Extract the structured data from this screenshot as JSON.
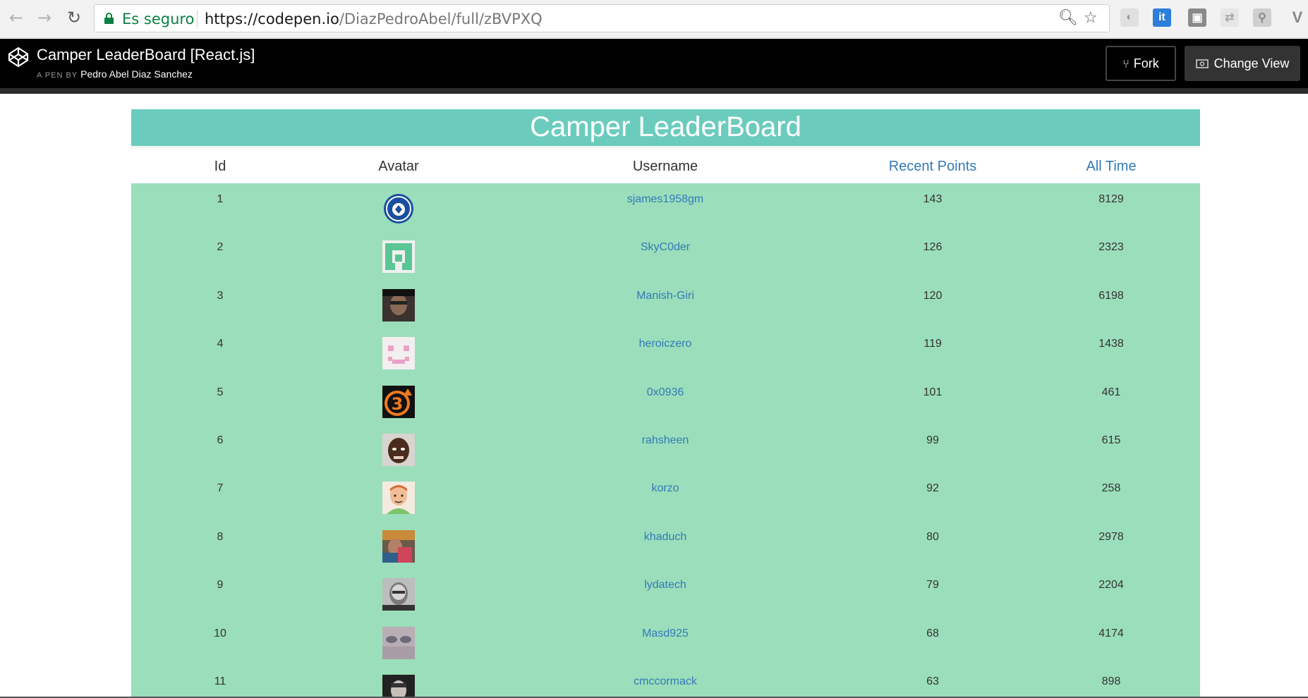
{
  "browser": {
    "secure_label": "Es seguro",
    "url_host": "https://codepen.io",
    "url_path": "/DiazPedroAbel/full/zBVPXQ"
  },
  "codepen": {
    "pen_title": "Camper LeaderBoard [React.js]",
    "byline_prefix": "A PEN BY",
    "author": "Pedro Abel Diaz Sanchez",
    "fork_label": "Fork",
    "change_view_label": "Change View"
  },
  "leaderboard": {
    "title": "Camper LeaderBoard",
    "columns": {
      "id": "Id",
      "avatar": "Avatar",
      "username": "Username",
      "recent": "Recent Points",
      "alltime": "All Time"
    },
    "rows": [
      {
        "id": "1",
        "username": "sjames1958gm",
        "recent": "143",
        "alltime": "8129",
        "avatar": "chelsea-badge"
      },
      {
        "id": "2",
        "username": "SkyC0der",
        "recent": "126",
        "alltime": "2323",
        "avatar": "green-identicon"
      },
      {
        "id": "3",
        "username": "Manish-Giri",
        "recent": "120",
        "alltime": "6198",
        "avatar": "photo-dark"
      },
      {
        "id": "4",
        "username": "heroiczero",
        "recent": "119",
        "alltime": "1438",
        "avatar": "pink-identicon"
      },
      {
        "id": "5",
        "username": "0x0936",
        "recent": "101",
        "alltime": "461",
        "avatar": "orange-3-logo"
      },
      {
        "id": "6",
        "username": "rahsheen",
        "recent": "99",
        "alltime": "615",
        "avatar": "photo-face"
      },
      {
        "id": "7",
        "username": "korzo",
        "recent": "92",
        "alltime": "258",
        "avatar": "cartoon-face"
      },
      {
        "id": "8",
        "username": "khaduch",
        "recent": "80",
        "alltime": "2978",
        "avatar": "photo-color"
      },
      {
        "id": "9",
        "username": "lydatech",
        "recent": "79",
        "alltime": "2204",
        "avatar": "photo-gray"
      },
      {
        "id": "10",
        "username": "Masd925",
        "recent": "68",
        "alltime": "4174",
        "avatar": "photo-closeup"
      },
      {
        "id": "11",
        "username": "cmccormack",
        "recent": "63",
        "alltime": "898",
        "avatar": "photo-dark-2"
      }
    ]
  }
}
